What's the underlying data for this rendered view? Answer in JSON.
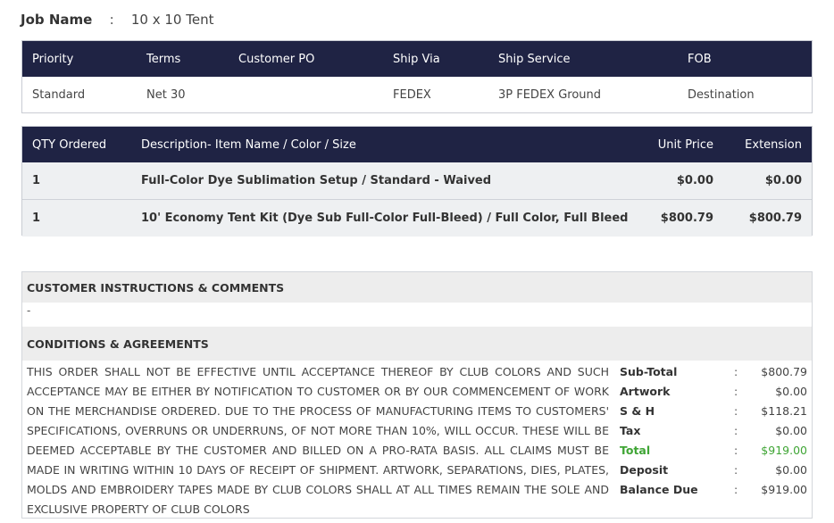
{
  "job": {
    "label": "Job Name",
    "colon": ":",
    "value": "10 x 10 Tent"
  },
  "order_table": {
    "headers": [
      "Priority",
      "Terms",
      "Customer PO",
      "Ship Via",
      "Ship Service",
      "FOB"
    ],
    "row": [
      "Standard",
      "Net 30",
      "",
      "FEDEX",
      "3P FEDEX Ground",
      "Destination"
    ]
  },
  "items_table": {
    "headers": [
      "QTY Ordered",
      "Description- Item Name / Color / Size",
      "Unit Price",
      "Extension"
    ],
    "rows": [
      [
        "1",
        "Full-Color Dye Sublimation Setup / Standard - Waived",
        "$0.00",
        "$0.00"
      ],
      [
        "1",
        "10' Economy Tent Kit (Dye Sub Full-Color Full-Bleed) / Full Color, Full Bleed",
        "$800.79",
        "$800.79"
      ]
    ]
  },
  "instructions": {
    "title": "CUSTOMER INSTRUCTIONS & COMMENTS",
    "text": "-"
  },
  "conditions": {
    "title": "CONDITIONS & AGREEMENTS",
    "text": "THIS ORDER SHALL NOT BE EFFECTIVE UNTIL ACCEPTANCE THEREOF BY CLUB COLORS AND SUCH ACCEPTANCE MAY BE EITHER BY NOTIFICATION TO CUSTOMER OR BY OUR COMMENCEMENT OF WORK ON THE MERCHANDISE ORDERED. DUE TO THE PROCESS OF MANUFACTURING ITEMS TO CUSTOMERS' SPECIFICATIONS, OVERRUNS OR UNDERRUNS, OF NOT MORE THAN 10%, WILL OCCUR. THESE WILL BE DEEMED ACCEPTABLE BY THE CUSTOMER AND BILLED ON A PRO-RATA BASIS. ALL CLAIMS MUST BE MADE IN WRITING WITHIN 10 DAYS OF RECEIPT OF SHIPMENT. ARTWORK, SEPARATIONS, DIES, PLATES, MOLDS AND EMBROIDERY TAPES MADE BY CLUB COLORS SHALL AT ALL TIMES REMAIN THE SOLE AND EXCLUSIVE PROPERTY OF CLUB COLORS"
  },
  "totals": {
    "colon": ":",
    "rows": [
      {
        "label": "Sub-Total",
        "value": "$800.79"
      },
      {
        "label": "Artwork",
        "value": "$0.00"
      },
      {
        "label": "S & H",
        "value": "$118.21"
      },
      {
        "label": "Tax",
        "value": "$0.00"
      },
      {
        "label": "Total",
        "value": "$919.00"
      },
      {
        "label": "Deposit",
        "value": "$0.00"
      },
      {
        "label": "Balance Due",
        "value": "$919.00"
      }
    ]
  },
  "colors": {
    "header_bg": "#1f2344",
    "total_green": "#3fa535",
    "section_bg": "#ededed"
  }
}
